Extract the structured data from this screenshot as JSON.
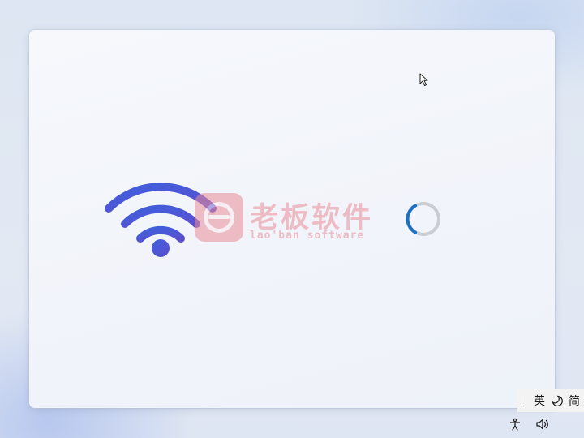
{
  "watermark": {
    "name_cn": "老板软件",
    "name_en": "lao'ban software"
  },
  "ime": {
    "mode": "英",
    "moon_icon": "moon-icon",
    "script": "简"
  },
  "icons": {
    "wifi": "wifi-icon",
    "spinner": "loading-spinner",
    "cursor": "mouse-pointer",
    "accessibility": "accessibility-icon",
    "volume": "volume-icon"
  },
  "colors": {
    "wifi_gradient_start": "#3f5fdc",
    "wifi_gradient_end": "#5b4fd0",
    "spinner_track": "#c9cdd3",
    "spinner_arc": "#1a6fc7",
    "watermark": "#e98d99"
  }
}
